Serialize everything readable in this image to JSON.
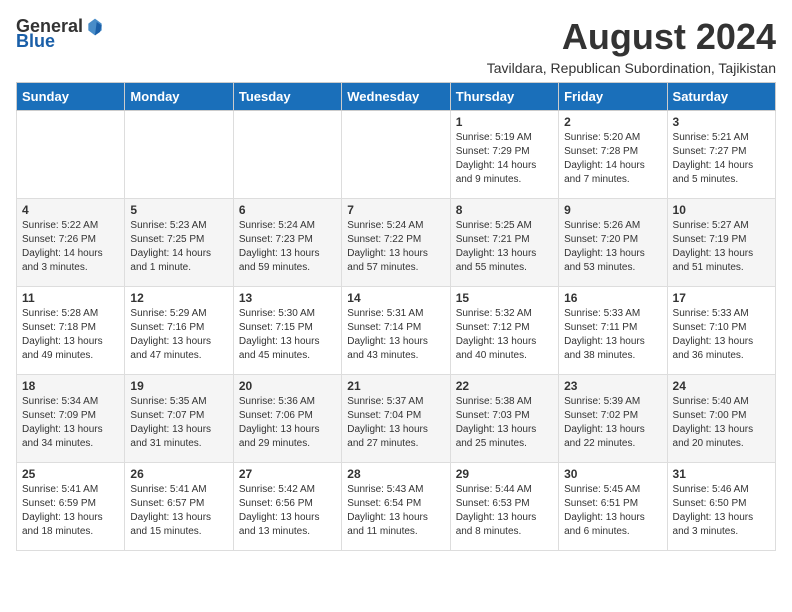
{
  "header": {
    "logo_general": "General",
    "logo_blue": "Blue",
    "month_title": "August 2024",
    "subtitle": "Tavildara, Republican Subordination, Tajikistan"
  },
  "days_of_week": [
    "Sunday",
    "Monday",
    "Tuesday",
    "Wednesday",
    "Thursday",
    "Friday",
    "Saturday"
  ],
  "weeks": [
    [
      {
        "day": "",
        "info": ""
      },
      {
        "day": "",
        "info": ""
      },
      {
        "day": "",
        "info": ""
      },
      {
        "day": "",
        "info": ""
      },
      {
        "day": "1",
        "info": "Sunrise: 5:19 AM\nSunset: 7:29 PM\nDaylight: 14 hours\nand 9 minutes."
      },
      {
        "day": "2",
        "info": "Sunrise: 5:20 AM\nSunset: 7:28 PM\nDaylight: 14 hours\nand 7 minutes."
      },
      {
        "day": "3",
        "info": "Sunrise: 5:21 AM\nSunset: 7:27 PM\nDaylight: 14 hours\nand 5 minutes."
      }
    ],
    [
      {
        "day": "4",
        "info": "Sunrise: 5:22 AM\nSunset: 7:26 PM\nDaylight: 14 hours\nand 3 minutes."
      },
      {
        "day": "5",
        "info": "Sunrise: 5:23 AM\nSunset: 7:25 PM\nDaylight: 14 hours\nand 1 minute."
      },
      {
        "day": "6",
        "info": "Sunrise: 5:24 AM\nSunset: 7:23 PM\nDaylight: 13 hours\nand 59 minutes."
      },
      {
        "day": "7",
        "info": "Sunrise: 5:24 AM\nSunset: 7:22 PM\nDaylight: 13 hours\nand 57 minutes."
      },
      {
        "day": "8",
        "info": "Sunrise: 5:25 AM\nSunset: 7:21 PM\nDaylight: 13 hours\nand 55 minutes."
      },
      {
        "day": "9",
        "info": "Sunrise: 5:26 AM\nSunset: 7:20 PM\nDaylight: 13 hours\nand 53 minutes."
      },
      {
        "day": "10",
        "info": "Sunrise: 5:27 AM\nSunset: 7:19 PM\nDaylight: 13 hours\nand 51 minutes."
      }
    ],
    [
      {
        "day": "11",
        "info": "Sunrise: 5:28 AM\nSunset: 7:18 PM\nDaylight: 13 hours\nand 49 minutes."
      },
      {
        "day": "12",
        "info": "Sunrise: 5:29 AM\nSunset: 7:16 PM\nDaylight: 13 hours\nand 47 minutes."
      },
      {
        "day": "13",
        "info": "Sunrise: 5:30 AM\nSunset: 7:15 PM\nDaylight: 13 hours\nand 45 minutes."
      },
      {
        "day": "14",
        "info": "Sunrise: 5:31 AM\nSunset: 7:14 PM\nDaylight: 13 hours\nand 43 minutes."
      },
      {
        "day": "15",
        "info": "Sunrise: 5:32 AM\nSunset: 7:12 PM\nDaylight: 13 hours\nand 40 minutes."
      },
      {
        "day": "16",
        "info": "Sunrise: 5:33 AM\nSunset: 7:11 PM\nDaylight: 13 hours\nand 38 minutes."
      },
      {
        "day": "17",
        "info": "Sunrise: 5:33 AM\nSunset: 7:10 PM\nDaylight: 13 hours\nand 36 minutes."
      }
    ],
    [
      {
        "day": "18",
        "info": "Sunrise: 5:34 AM\nSunset: 7:09 PM\nDaylight: 13 hours\nand 34 minutes."
      },
      {
        "day": "19",
        "info": "Sunrise: 5:35 AM\nSunset: 7:07 PM\nDaylight: 13 hours\nand 31 minutes."
      },
      {
        "day": "20",
        "info": "Sunrise: 5:36 AM\nSunset: 7:06 PM\nDaylight: 13 hours\nand 29 minutes."
      },
      {
        "day": "21",
        "info": "Sunrise: 5:37 AM\nSunset: 7:04 PM\nDaylight: 13 hours\nand 27 minutes."
      },
      {
        "day": "22",
        "info": "Sunrise: 5:38 AM\nSunset: 7:03 PM\nDaylight: 13 hours\nand 25 minutes."
      },
      {
        "day": "23",
        "info": "Sunrise: 5:39 AM\nSunset: 7:02 PM\nDaylight: 13 hours\nand 22 minutes."
      },
      {
        "day": "24",
        "info": "Sunrise: 5:40 AM\nSunset: 7:00 PM\nDaylight: 13 hours\nand 20 minutes."
      }
    ],
    [
      {
        "day": "25",
        "info": "Sunrise: 5:41 AM\nSunset: 6:59 PM\nDaylight: 13 hours\nand 18 minutes."
      },
      {
        "day": "26",
        "info": "Sunrise: 5:41 AM\nSunset: 6:57 PM\nDaylight: 13 hours\nand 15 minutes."
      },
      {
        "day": "27",
        "info": "Sunrise: 5:42 AM\nSunset: 6:56 PM\nDaylight: 13 hours\nand 13 minutes."
      },
      {
        "day": "28",
        "info": "Sunrise: 5:43 AM\nSunset: 6:54 PM\nDaylight: 13 hours\nand 11 minutes."
      },
      {
        "day": "29",
        "info": "Sunrise: 5:44 AM\nSunset: 6:53 PM\nDaylight: 13 hours\nand 8 minutes."
      },
      {
        "day": "30",
        "info": "Sunrise: 5:45 AM\nSunset: 6:51 PM\nDaylight: 13 hours\nand 6 minutes."
      },
      {
        "day": "31",
        "info": "Sunrise: 5:46 AM\nSunset: 6:50 PM\nDaylight: 13 hours\nand 3 minutes."
      }
    ]
  ]
}
